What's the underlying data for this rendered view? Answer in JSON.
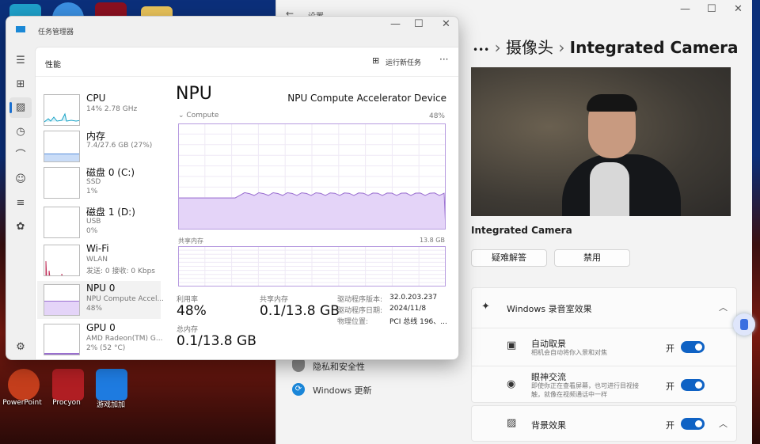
{
  "desktop": {
    "icons": [
      {
        "label": "PowerPoint",
        "color": "#c43e1c"
      },
      {
        "label": "Procyon",
        "color": "#b01e23"
      },
      {
        "label": "游戏加加",
        "color": "#1e7be0"
      }
    ]
  },
  "settings": {
    "title": "设置",
    "breadcrumb": {
      "more": "•••",
      "parent": "摄像头",
      "sep": "›",
      "current": "Integrated Camera"
    },
    "camera_name": "Integrated Camera",
    "troubleshoot": "疑难解答",
    "disable": "禁用",
    "nav": [
      {
        "label": "隐私和安全性",
        "icon": "shield-icon"
      },
      {
        "label": "Windows 更新",
        "icon": "update-icon"
      }
    ],
    "studio_effects": {
      "title": "Windows 录音室效果",
      "items": [
        {
          "title": "自动取景",
          "desc": "相机会自动将你入景和对焦",
          "state": "开",
          "on": true
        },
        {
          "title": "眼神交流",
          "desc1": "即使你正在查看屏幕，也可进行目视接",
          "desc2": "触，就像在视频通话中一样",
          "state": "开",
          "on": true
        }
      ]
    },
    "background": {
      "title": "背景效果",
      "state": "开",
      "on": true
    }
  },
  "taskmgr": {
    "title": "任务管理器",
    "section": "性能",
    "run_new_task": "运行新任务",
    "more": "···",
    "devices": [
      {
        "name": "CPU",
        "l2": "14% 2.78 GHz",
        "l3": "",
        "color": "#17a2c6"
      },
      {
        "name": "内存",
        "l2": "7.4/27.6 GB (27%)",
        "l3": "",
        "color": "#5a8fdc"
      },
      {
        "name": "磁盘 0 (C:)",
        "l2": "SSD",
        "l3": "1%",
        "color": "#4caf50"
      },
      {
        "name": "磁盘 1 (D:)",
        "l2": "USB",
        "l3": "0%",
        "color": "#4caf50"
      },
      {
        "name": "Wi-Fi",
        "l2": "WLAN",
        "l3": "发送: 0 接收: 0 Kbps",
        "color": "#c0305a"
      },
      {
        "name": "NPU 0",
        "l2": "NPU Compute Accel...",
        "l3": "48%",
        "color": "#9a6fd0"
      },
      {
        "name": "GPU 0",
        "l2": "AMD Radeon(TM) G...",
        "l3": "2% (52 °C)",
        "color": "#9a6fd0"
      }
    ],
    "detail": {
      "heading": "NPU",
      "device": "NPU Compute Accelerator Device",
      "graph_label": "Compute",
      "graph_max": "48%",
      "graph_value": 48,
      "mem_label": "共享内存",
      "mem_max": "13.8 GB",
      "util_label": "利用率",
      "util": "48%",
      "shared_label": "共享内存",
      "shared": "0.1/13.8 GB",
      "total_label": "总内存",
      "total": "0.1/13.8 GB",
      "info": [
        {
          "k": "驱动程序版本:",
          "v": "32.0.203.237"
        },
        {
          "k": "驱动程序日期:",
          "v": "2024/11/8"
        },
        {
          "k": "物理位置:",
          "v": "PCI 总线 196、..."
        }
      ]
    }
  }
}
